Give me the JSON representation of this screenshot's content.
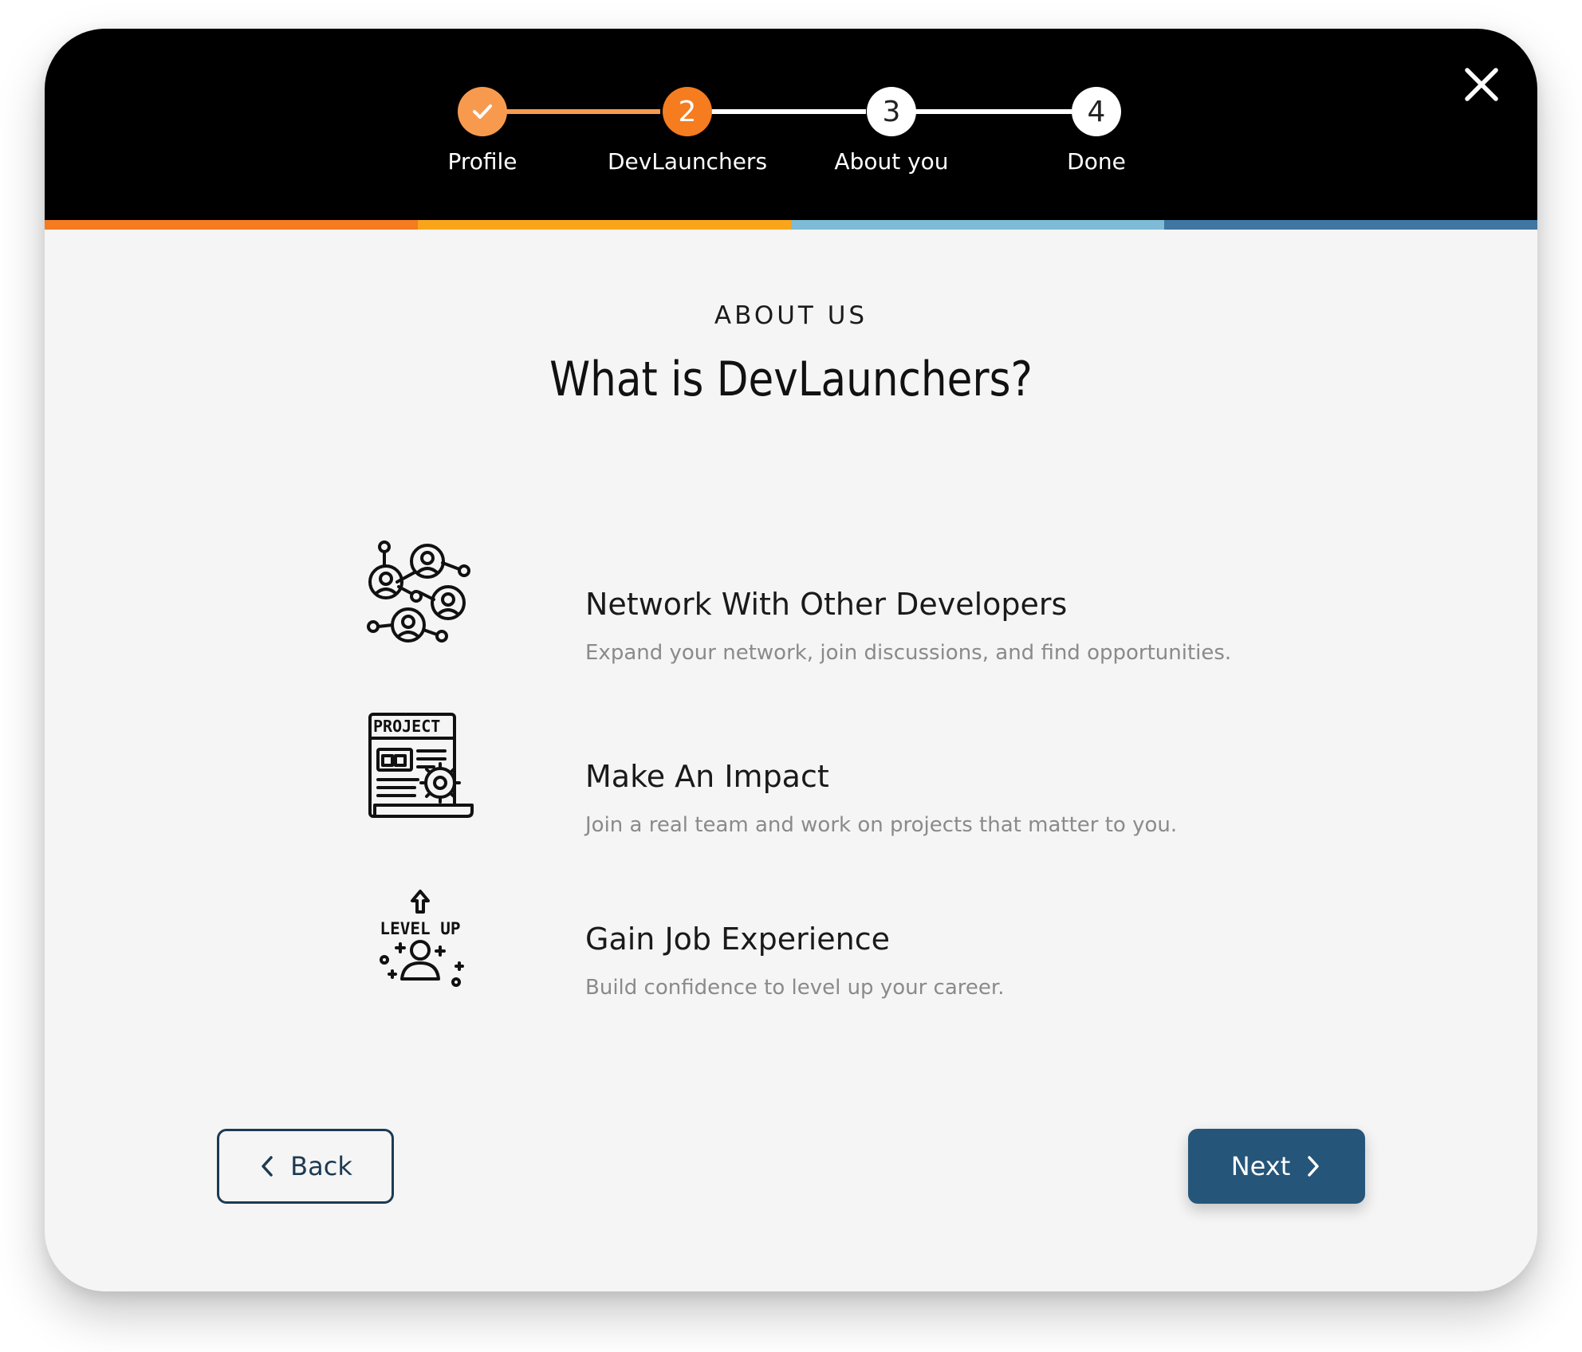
{
  "close": {
    "icon": "close-icon"
  },
  "stepper": {
    "steps": [
      {
        "label": "Profile",
        "status": "completed",
        "icon": "check-icon"
      },
      {
        "label": "DevLaunchers",
        "number": "2",
        "status": "current"
      },
      {
        "label": "About you",
        "number": "3",
        "status": "upcoming"
      },
      {
        "label": "Done",
        "number": "4",
        "status": "upcoming"
      }
    ]
  },
  "colors": {
    "header_bg": "#000000",
    "step_completed": "#F89A4E",
    "step_current": "#F57C1F",
    "stripe": [
      "#F47B20",
      "#F9A51A",
      "#7DBBD6",
      "#3F76A2"
    ],
    "primary_button": "#26557A",
    "back_button_border": "#1D3A52"
  },
  "content": {
    "eyebrow": "ABOUT US",
    "title": "What is DevLaunchers?",
    "features": [
      {
        "icon": "network-people-icon",
        "title": "Network With Other Developers",
        "description": "Expand your network, join discussions, and find opportunities."
      },
      {
        "icon": "project-document-icon",
        "title": "Make An Impact",
        "description": "Join a real team and work on projects that matter to you."
      },
      {
        "icon": "level-up-icon",
        "title": "Gain Job Experience",
        "description": "Build confidence to level up your career.",
        "icon_text": "LEVEL UP"
      }
    ]
  },
  "navigation": {
    "back_label": "Back",
    "next_label": "Next"
  }
}
